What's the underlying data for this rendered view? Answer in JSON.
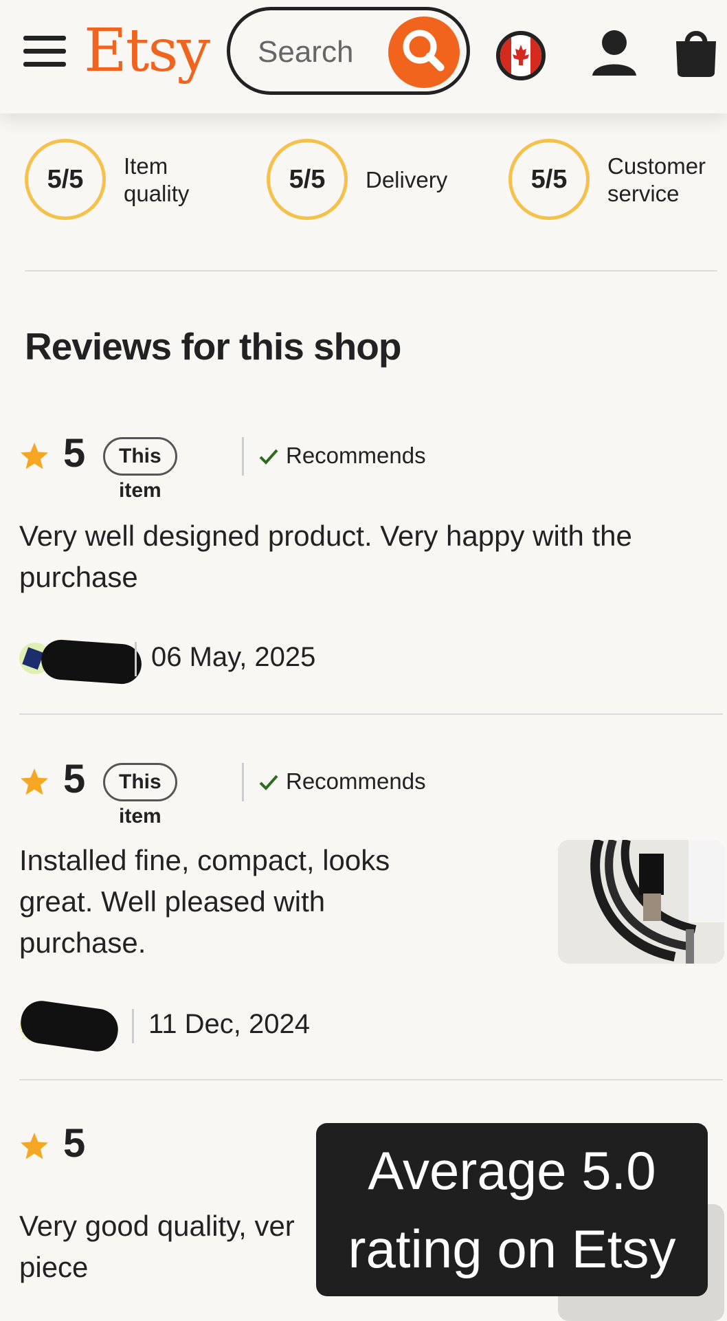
{
  "header": {
    "logo": "Etsy",
    "search_placeholder": "Search"
  },
  "shop_ratings": [
    {
      "value": "5/5",
      "label_line1": "Item",
      "label_line2": "quality"
    },
    {
      "value": "5/5",
      "label_line1": "Delivery",
      "label_line2": ""
    },
    {
      "value": "5/5",
      "label_line1": "Customer",
      "label_line2": "service"
    }
  ],
  "reviews_title": "Reviews for this shop",
  "reviews": [
    {
      "rating": "5",
      "badge": "This item",
      "recommends": "Recommends",
      "text_line1": "Very well designed product. Very happy with the",
      "text_line2": "purchase",
      "date": "06 May, 2025"
    },
    {
      "rating": "5",
      "badge": "This item",
      "recommends": "Recommends",
      "text_line1": "Installed fine, compact, looks",
      "text_line2": "great. Well pleased with",
      "text_line3": "purchase.",
      "date": "11 Dec, 2024"
    },
    {
      "rating": "5",
      "text_line1": "Very good quality, ver",
      "text_line2": "piece"
    }
  ],
  "overlay": {
    "line1": "Average 5.0",
    "line2": "rating on Etsy"
  },
  "colors": {
    "brand": "#f1641e",
    "star": "#f5a623",
    "rating_ring": "#f5c14a",
    "check": "#2f6b1f",
    "background": "#f8f7f3"
  }
}
